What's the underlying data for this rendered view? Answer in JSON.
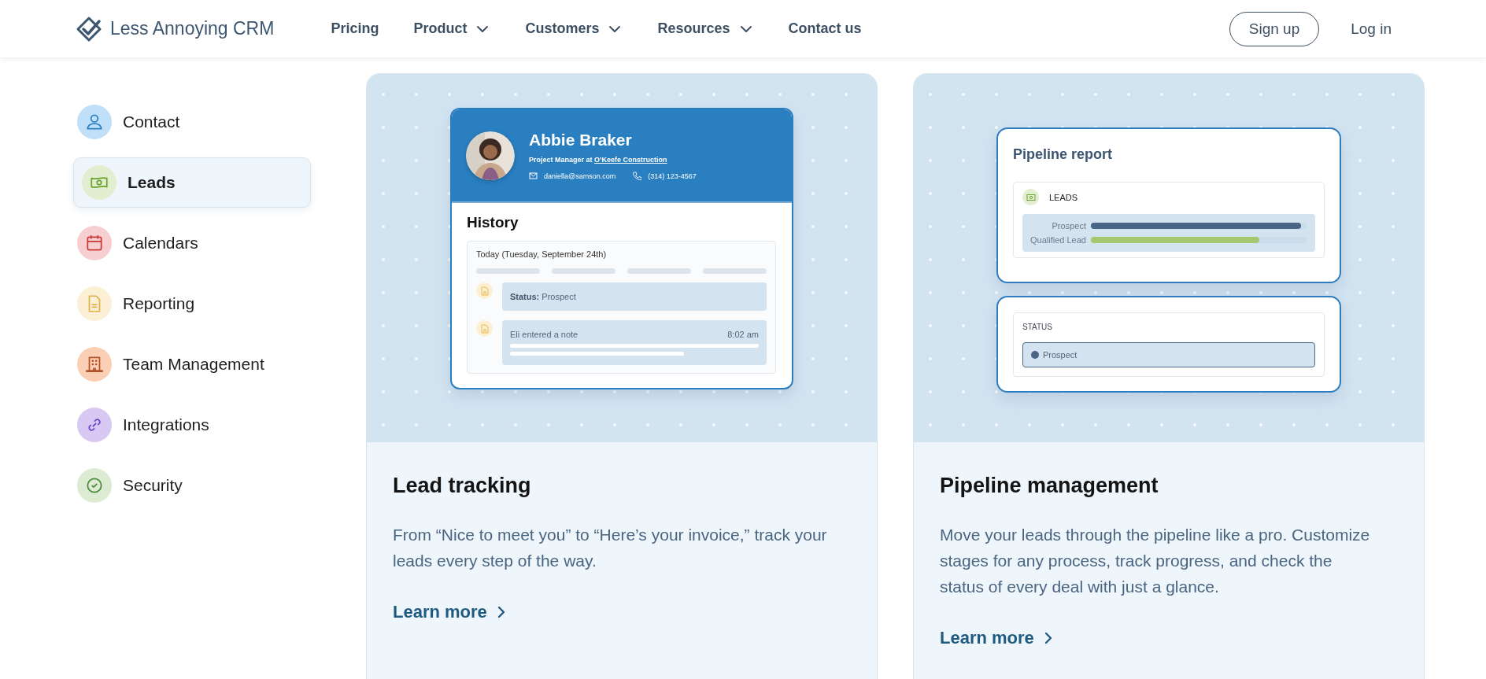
{
  "header": {
    "logo_text": "Less Annoying CRM",
    "nav": [
      {
        "label": "Pricing",
        "has_menu": false
      },
      {
        "label": "Product",
        "has_menu": true
      },
      {
        "label": "Customers",
        "has_menu": true
      },
      {
        "label": "Resources",
        "has_menu": true
      },
      {
        "label": "Contact us",
        "has_menu": false
      }
    ],
    "sign_up": "Sign up",
    "log_in": "Log in"
  },
  "sidebar": {
    "items": [
      {
        "label": "Contact",
        "selected": false,
        "color": "#bfe0f8"
      },
      {
        "label": "Leads",
        "selected": true,
        "color": "#e3edcf"
      },
      {
        "label": "Calendars",
        "selected": false,
        "color": "#f7cfd0"
      },
      {
        "label": "Reporting",
        "selected": false,
        "color": "#fbefd6"
      },
      {
        "label": "Team Management",
        "selected": false,
        "color": "#fbcfb3"
      },
      {
        "label": "Integrations",
        "selected": false,
        "color": "#d9c8f3"
      },
      {
        "label": "Security",
        "selected": false,
        "color": "#dcebd2"
      }
    ]
  },
  "cards": [
    {
      "kind": "contact",
      "title": "Lead tracking",
      "description": "From “Nice to meet you” to “Here’s your invoice,” track your leads every step of the way.",
      "link": "Learn more",
      "mock": {
        "name": "Abbie Braker",
        "role": "Project Manager at",
        "company": "O’Keefe Construction",
        "email": "daniella@samson.com",
        "phone": "(314) 123-4567",
        "history_title": "History",
        "date": "Today (Tuesday, September 24th)",
        "entries": [
          {
            "kind": "status",
            "text": "**Status:** Prospect"
          },
          {
            "kind": "note",
            "text": "Eli entered a note",
            "time": "8:02 am"
          }
        ]
      }
    },
    {
      "kind": "pipeline",
      "title": "Pipeline management",
      "description": "Move your leads through the pipeline like a pro. Customize stages for any process, track progress, and check the status of every deal with just a glance.",
      "link": "Learn more",
      "mock": {
        "title": "Pipeline report",
        "section": "LEADS",
        "bars": [
          {
            "label": "Prospect",
            "level": 0.97,
            "color": "#4a6585"
          },
          {
            "label": "Qualified Lead",
            "level": 0.78,
            "color": "#a3c86e"
          }
        ],
        "status_label": "STATUS",
        "status_value": "Prospect"
      }
    }
  ]
}
